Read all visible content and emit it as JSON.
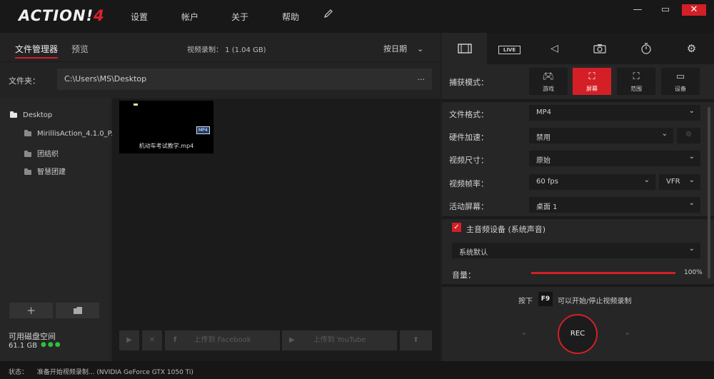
{
  "app": {
    "logo_text": "ACTION!",
    "logo_version": "4"
  },
  "menu": {
    "settings": "设置",
    "account": "帐户",
    "about": "关于",
    "help": "帮助"
  },
  "window": {
    "minimize": "—",
    "restore": "▭",
    "close": "✕"
  },
  "left": {
    "tabs": {
      "file_manager": "文件管理器",
      "preview": "预览"
    },
    "recording_info": "视频录制： 1 (1.04 GB)",
    "sort": "按日期",
    "folder_label": "文件夹：",
    "folder_path": "C:\\Users\\MS\\Desktop",
    "folder_more": "...",
    "tree": [
      "Desktop",
      "MirillisAction_4.1.0_P...",
      "团结织",
      "智慧团建"
    ],
    "thumbnail": {
      "badge": "MP4",
      "filename": "机动车考试教学.mp4"
    },
    "add_label": "+",
    "disk_label": "可用磁盘空间",
    "disk_value": "61.1 GB",
    "upload_facebook": "上传到 Facebook",
    "upload_youtube": "上传到 YouTube"
  },
  "right": {
    "capture_label": "捕获模式：",
    "capture_modes": [
      "游戏",
      "屏幕",
      "范围",
      "设备"
    ],
    "live_label": "LIVE",
    "file_format_label": "文件格式：",
    "file_format": "MP4",
    "hw_accel_label": "硬件加速：",
    "hw_accel": "禁用",
    "video_size_label": "视频尺寸：",
    "video_size": "原始",
    "fps_label": "视频帧率：",
    "fps": "60 fps",
    "fps_mode": "VFR",
    "screen_label": "活动屏幕：",
    "screen": "桌面 1",
    "audio_device_label": "主音频设备 (系统声音)",
    "audio_device": "系统默认",
    "volume_label": "音量：",
    "volume_value": "100%",
    "volume_fraction": 1.0,
    "hotkey_prefix": "按下",
    "hotkey_key": "F9",
    "hotkey_suffix": "可以开始/停止视频录制",
    "rec": "REC"
  },
  "status": {
    "label": "状态：",
    "text": "准备开始视频录制... (NVIDIA GeForce GTX 1050 Ti)"
  },
  "colors": {
    "accent": "#d41f26"
  }
}
